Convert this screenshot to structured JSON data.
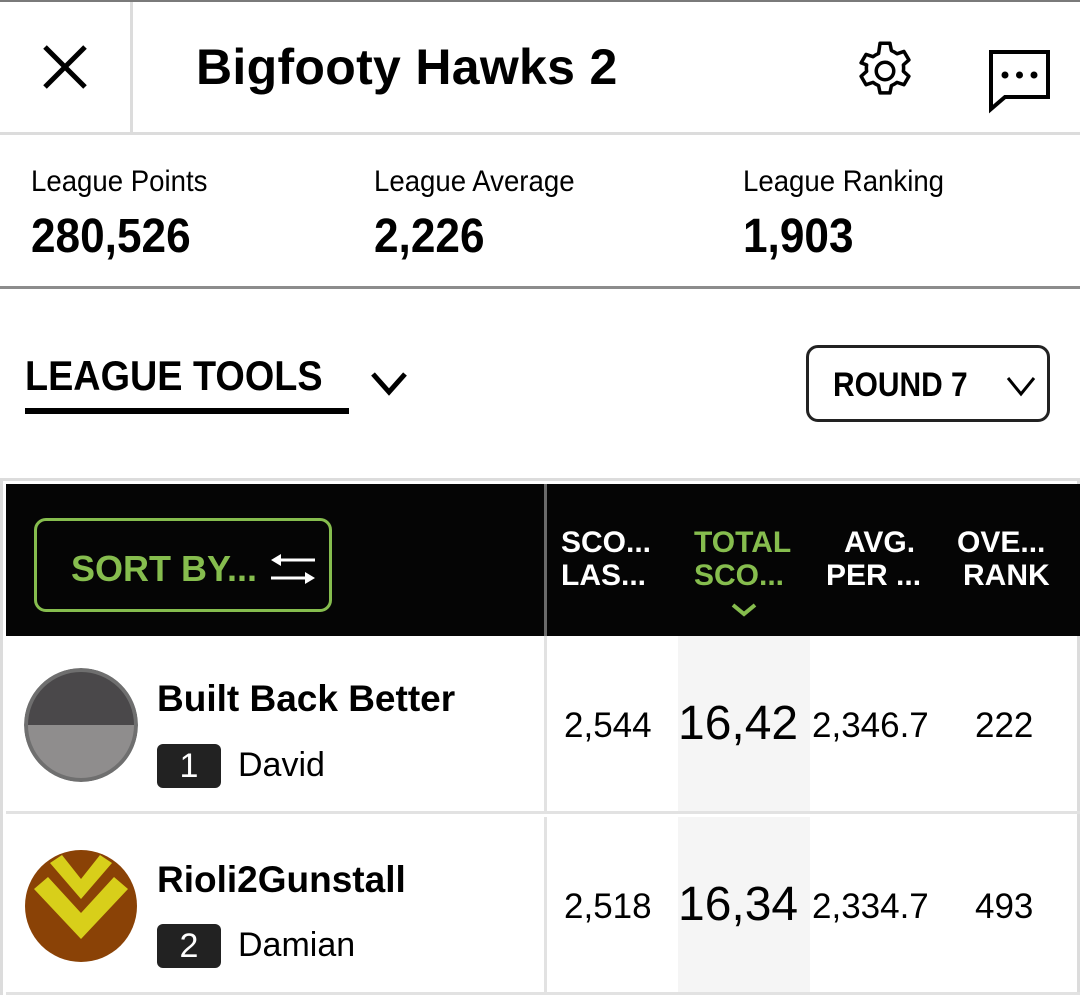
{
  "header": {
    "title": "Bigfooty Hawks 2",
    "close_icon": "close-icon",
    "settings_icon": "gear-icon",
    "chat_icon": "chat-bubble-ellipsis-icon"
  },
  "stats": [
    {
      "label": "League Points",
      "value": "280,526"
    },
    {
      "label": "League Average",
      "value": "2,226"
    },
    {
      "label": "League Ranking",
      "value": "1,903"
    }
  ],
  "tools": {
    "label": "LEAGUE TOOLS",
    "chevron_icon": "chevron-down-icon",
    "round_selected": "ROUND 7"
  },
  "table": {
    "sort_button_label": "SORT BY...",
    "sort_icon": "swap-arrows-icon",
    "columns": [
      {
        "line1": "SCO...",
        "line2": "LAS...",
        "active": false
      },
      {
        "line1": "TOTAL",
        "line2": "SCO...",
        "active": true
      },
      {
        "line1": "AVG.",
        "line2": "PER ...",
        "active": false
      },
      {
        "line1": "OVE...",
        "line2": "RANK",
        "active": false
      }
    ],
    "accent_color": "#86bd4e",
    "rows": [
      {
        "team": "Built Back Better",
        "rank": "1",
        "owner": "David",
        "score_last": "2,544",
        "total_score": "16,42",
        "avg_per": "2,346.7",
        "overall_rank": "222",
        "avatar": "gray-half-circle-avatar"
      },
      {
        "team": "Rioli2Gunstall",
        "rank": "2",
        "owner": "Damian",
        "score_last": "2,518",
        "total_score": "16,34",
        "avg_per": "2,334.7",
        "overall_rank": "493",
        "avatar": "brown-yellow-chevron-avatar"
      }
    ]
  }
}
